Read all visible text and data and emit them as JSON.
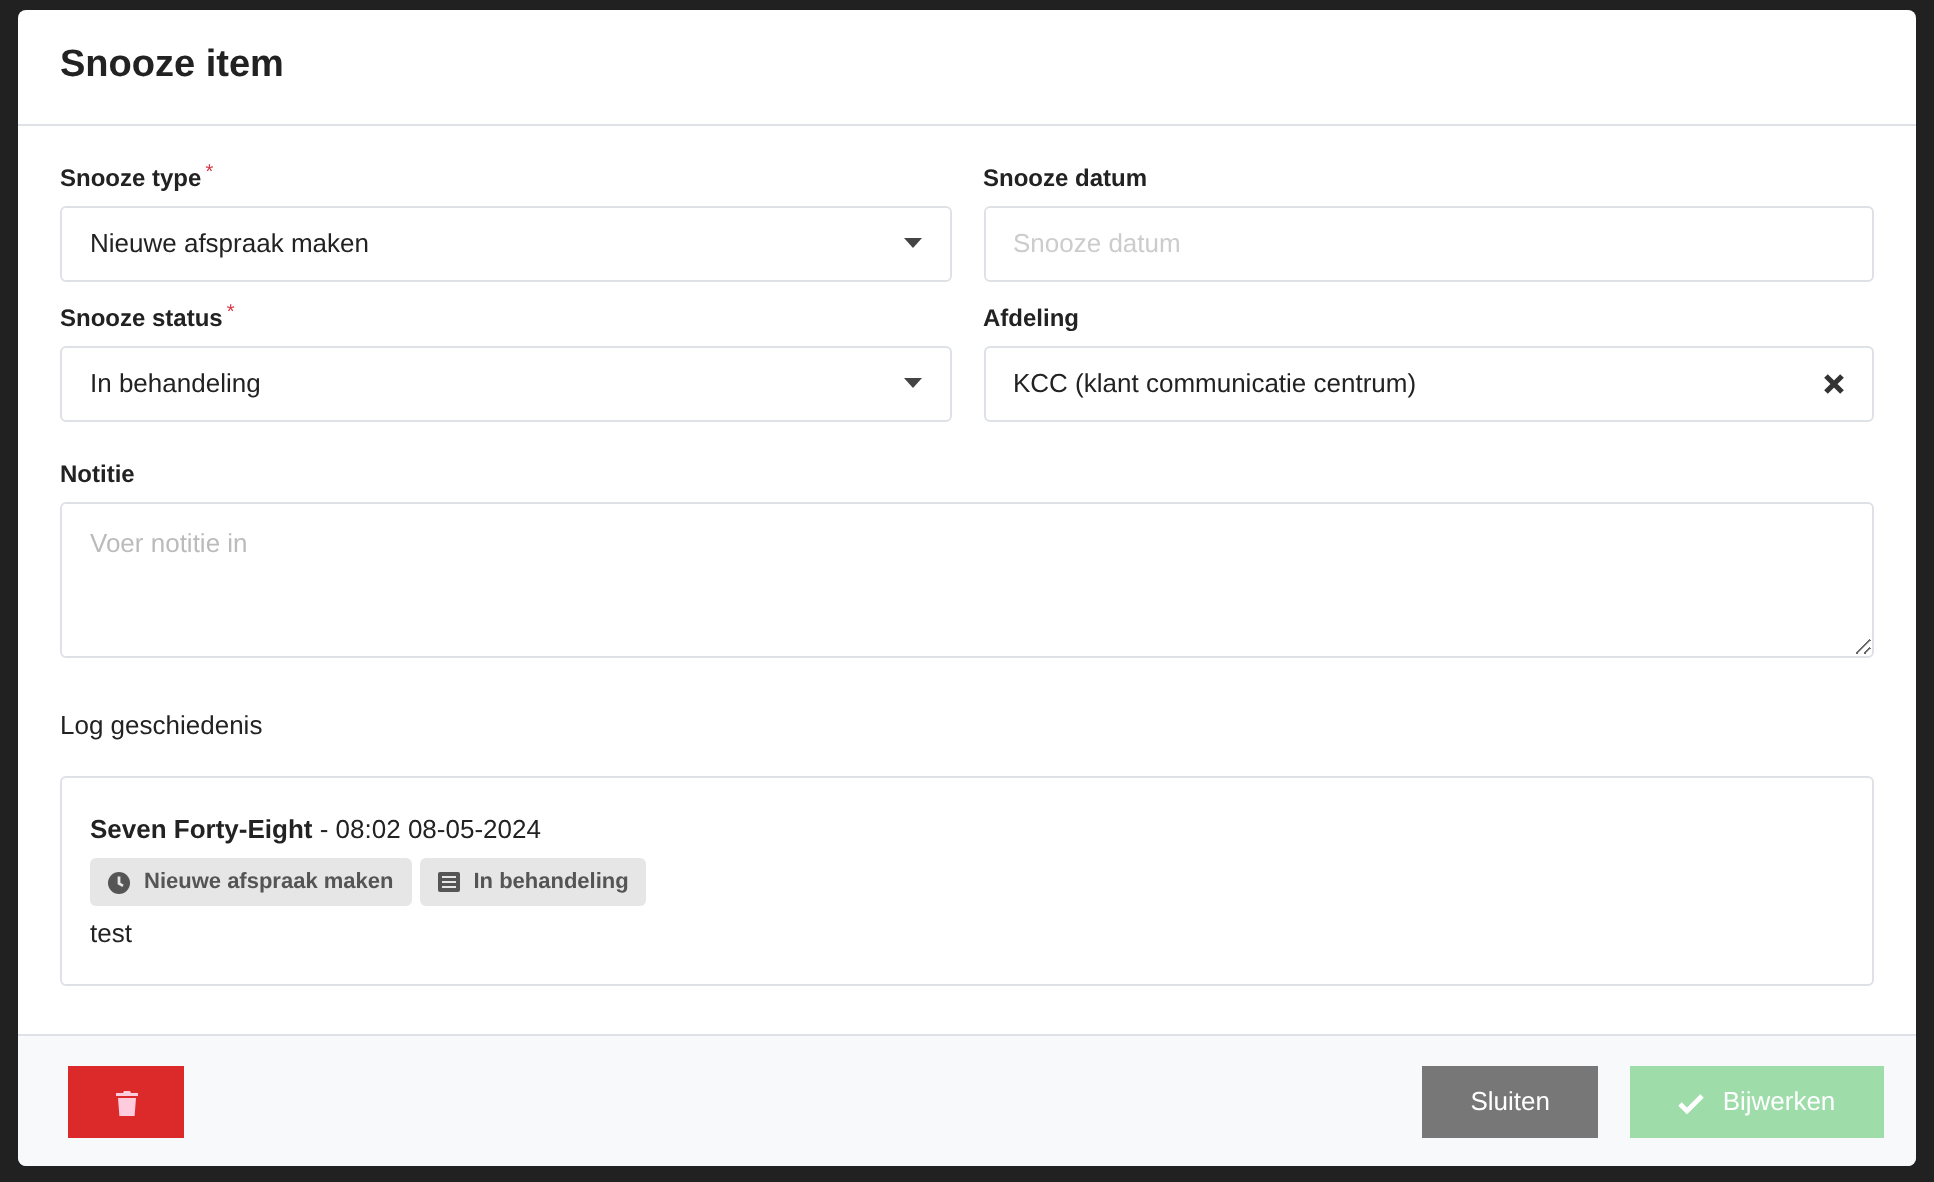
{
  "modal": {
    "title": "Snooze item"
  },
  "fields": [
    {
      "kind": "select",
      "label": "Snooze type",
      "required_marker": "*",
      "value": "Nieuwe afspraak maken"
    },
    {
      "kind": "text",
      "label": "Snooze datum",
      "placeholder": "Snooze datum"
    },
    {
      "kind": "select",
      "label": "Snooze status",
      "required_marker": "*",
      "value": "In behandeling"
    },
    {
      "kind": "clearable",
      "label": "Afdeling",
      "value": "KCC (klant communicatie centrum)"
    }
  ],
  "note": {
    "label": "Notitie",
    "placeholder": "Voer notitie in"
  },
  "log": {
    "heading": "Log geschiedenis",
    "entries": [
      {
        "author": "Seven Forty-Eight",
        "time": " - 08:02 08-05-2024",
        "tags": [
          {
            "kind": "type",
            "text": "Nieuwe afspraak maken"
          },
          {
            "kind": "status",
            "text": "In behandeling"
          }
        ],
        "text": "test"
      }
    ]
  },
  "footer": {
    "close_label": "Sluiten",
    "update_label": "Bijwerken",
    "update_disabled": true
  }
}
